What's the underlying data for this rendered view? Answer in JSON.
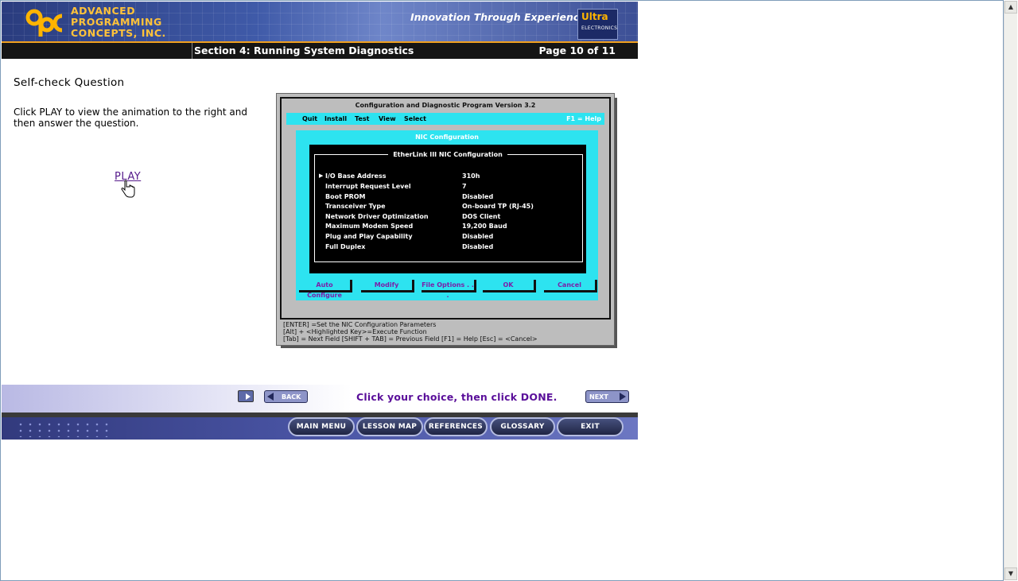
{
  "header": {
    "company_lines": [
      "ADVANCED",
      "PROGRAMMING",
      "CONCEPTS, INC."
    ],
    "tagline": "Innovation Through Experience",
    "partner_name": "Ultra",
    "partner_sub": "ELECTRONICS",
    "section": "Section 4: Running System Diagnostics",
    "page": "Page 10 of 11"
  },
  "content": {
    "heading": "Self-check Question",
    "instruction": "Click PLAY to view the animation to the right and then answer the question.",
    "play_link": "PLAY"
  },
  "dos_screen": {
    "title": "Configuration and Diagnostic Program   Version 3.2",
    "menu": [
      "Quit",
      "Install",
      "Test",
      "View",
      "Select"
    ],
    "help": "F1 = Help",
    "panel_title": "NIC Configuration",
    "sub_title": "EtherLink III NIC Configuration",
    "parameters": [
      {
        "label": "I/O Base Address",
        "value": "310h"
      },
      {
        "label": "Interrupt Request Level",
        "value": "7"
      },
      {
        "label": "Boot PROM",
        "value": "Disabled"
      },
      {
        "label": "Transceiver Type",
        "value": "On-board TP (RJ-45)"
      },
      {
        "label": "Network Driver Optimization",
        "value": "DOS Client"
      },
      {
        "label": "Maximum Modem Speed",
        "value": "19,200 Baud"
      },
      {
        "label": "Plug and Play Capability",
        "value": "Disabled"
      },
      {
        "label": "Full Duplex",
        "value": "Disabled"
      }
    ],
    "buttons": [
      "Auto Configure",
      "Modify",
      "File Options . . .",
      "OK",
      "Cancel"
    ],
    "hints": [
      "[ENTER] =Set the NIC Configuration Parameters",
      "[Alt] + <Highlighted  Key>=Execute Function",
      "[Tab] = Next Field    [SHIFT + TAB] = Previous Field    [F1] = Help    [Esc] = <Cancel>"
    ]
  },
  "navigation": {
    "back_label": "BACK",
    "next_label": "NEXT",
    "instruction": "Click your choice, then click DONE."
  },
  "bottom_menu": [
    "MAIN MENU",
    "LESSON MAP",
    "REFERENCES",
    "GLOSSARY",
    "EXIT"
  ],
  "colors": {
    "accent_orange": "#ffc23a",
    "banner_blue": "#3f5aa8",
    "dos_cyan": "#2de3f0",
    "choice_text": "#5a0f9a"
  }
}
